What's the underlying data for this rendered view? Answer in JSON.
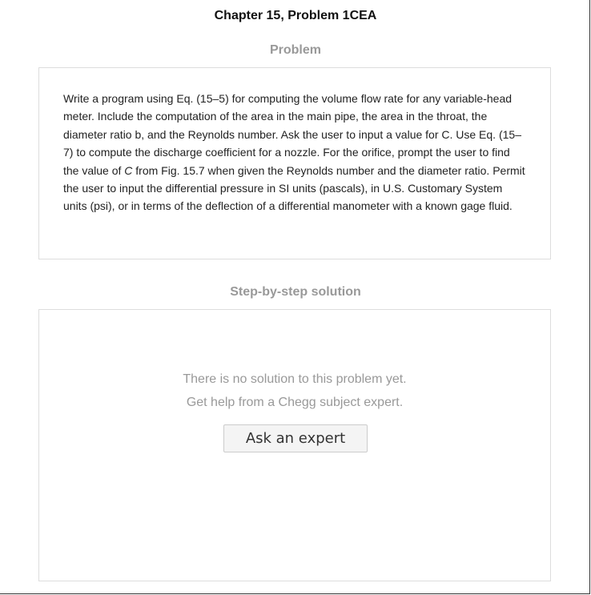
{
  "page": {
    "title": "Chapter 15, Problem 1CEA"
  },
  "problem": {
    "heading": "Problem",
    "text_part1": "Write a program using Eq. (15–5) for computing the volume flow rate for any variable-head meter. Include the computation of the area in the main pipe, the area in the throat, the diameter ratio b, and the Reynolds number. Ask the user to input a value for C. Use Eq. (15–7) to compute the discharge coefficient for a nozzle. For the orifice, prompt the user to find the value of ",
    "text_italic": "C",
    "text_part2": " from Fig. 15.7 when given the Reynolds number and the diameter ratio. Permit the user to input the differential pressure in SI units (pascals), in U.S. Customary System units (psi), or in terms of the deflection of a differential manometer with a known gage fluid."
  },
  "solution": {
    "heading": "Step-by-step solution",
    "no_solution_text": "There is no solution to this problem yet.",
    "help_text": "Get help from a Chegg subject expert.",
    "ask_button_label": "Ask an expert"
  },
  "colors": {
    "heading_gray": "#999999",
    "panel_border": "#dddddd",
    "button_bg": "#f4f4f4"
  }
}
